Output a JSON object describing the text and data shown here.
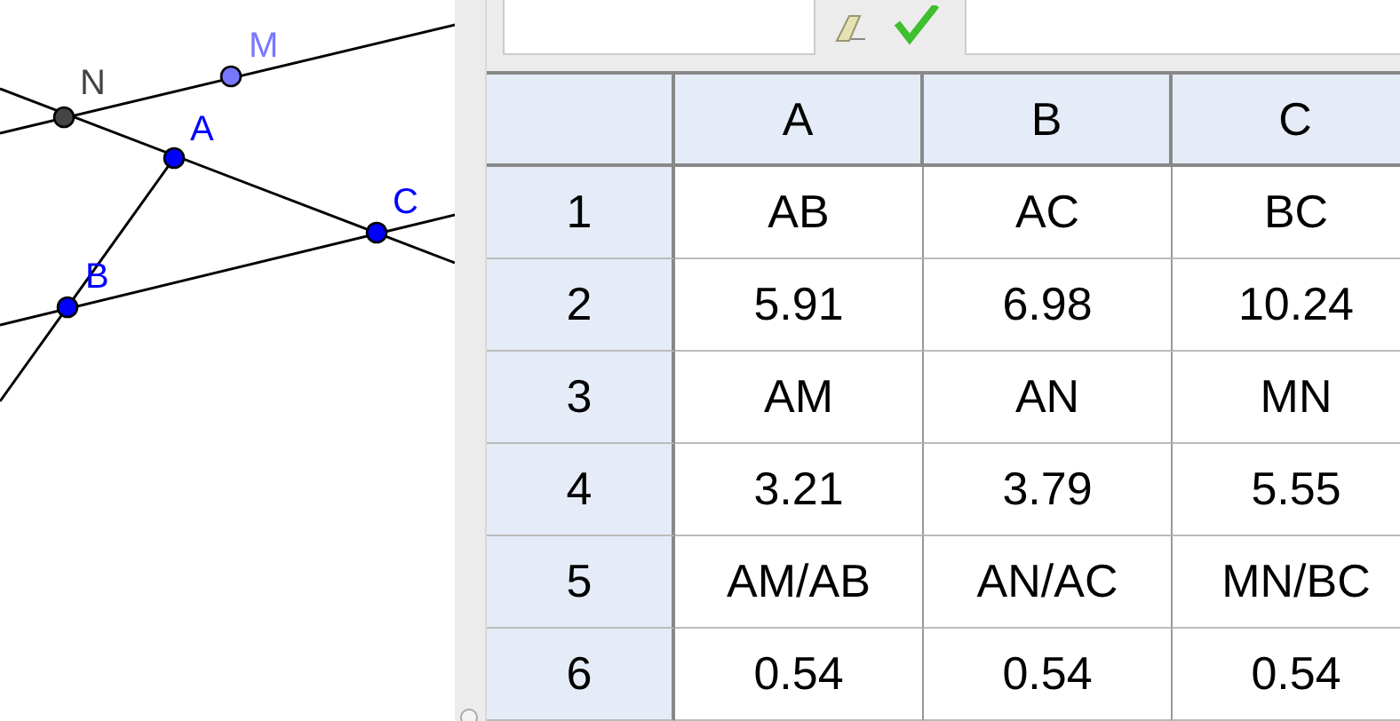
{
  "geometry": {
    "points": [
      {
        "label": "N",
        "color": "#444444"
      },
      {
        "label": "M",
        "color": "#7878ff"
      },
      {
        "label": "A",
        "color": "#0000ff"
      },
      {
        "label": "C",
        "color": "#0000ff"
      },
      {
        "label": "B",
        "color": "#0000ff"
      }
    ]
  },
  "spreadsheet": {
    "columns": [
      "A",
      "B",
      "C"
    ],
    "rows": [
      {
        "header": "1",
        "cells": [
          "AB",
          "AC",
          "BC"
        ]
      },
      {
        "header": "2",
        "cells": [
          "5.91",
          "6.98",
          "10.24"
        ]
      },
      {
        "header": "3",
        "cells": [
          "AM",
          "AN",
          "MN"
        ]
      },
      {
        "header": "4",
        "cells": [
          "3.21",
          "3.79",
          "5.55"
        ]
      },
      {
        "header": "5",
        "cells": [
          "AM/AB",
          "AN/AC",
          "MN/BC"
        ]
      },
      {
        "header": "6",
        "cells": [
          "0.54",
          "0.54",
          "0.54"
        ]
      }
    ]
  }
}
